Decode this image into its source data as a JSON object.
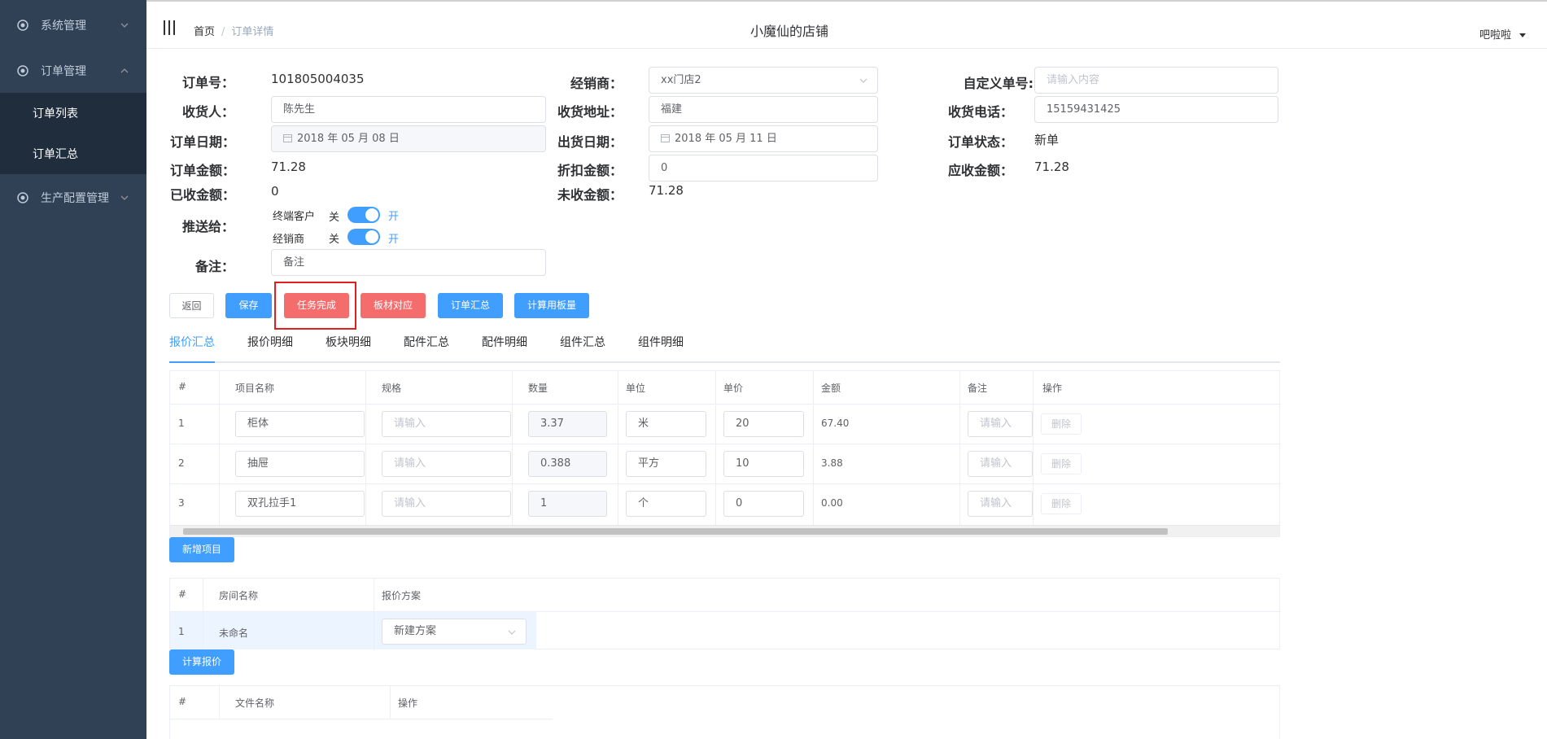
{
  "sidebar": {
    "menu": [
      {
        "label": "系统管理"
      },
      {
        "label": "订单管理"
      },
      {
        "label": "生产配置管理"
      }
    ],
    "submenu": [
      {
        "label": "订单列表"
      },
      {
        "label": "订单汇总"
      }
    ]
  },
  "header": {
    "breadcrumb_home": "首页",
    "breadcrumb_sep": "/",
    "breadcrumb_current": "订单详情",
    "shop_title": "小魔仙的店铺",
    "user": "吧啦啦"
  },
  "form": {
    "order_no_label": "订单号：",
    "order_no": "101805004035",
    "dealer_label": "经销商：",
    "dealer": "xx门店2",
    "custom_no_label": "自定义单号:",
    "custom_no_placeholder": "请输入内容",
    "receiver_label": "收货人：",
    "receiver": "陈先生",
    "address_label": "收货地址：",
    "address": "福建",
    "phone_label": "收货电话：",
    "phone": "15159431425",
    "order_date_label": "订单日期：",
    "order_date": "2018 年 05 月 08 日",
    "ship_date_label": "出货日期：",
    "ship_date": "2018 年 05 月 11 日",
    "status_label": "订单状态：",
    "status": "新单",
    "amount_label": "订单金额：",
    "amount": "71.28",
    "discount_label": "折扣金额：",
    "discount": "0",
    "receivable_label": "应收金额：",
    "receivable": "71.28",
    "received_label": "已收金额：",
    "received": "0",
    "unreceived_label": "未收金额：",
    "unreceived": "71.28",
    "push_label": "推送给：",
    "push_customer": "终端客户",
    "push_dealer": "经销商",
    "switch_off": "关",
    "switch_on": "开",
    "remark_label": "备注：",
    "remark": "备注"
  },
  "buttons": {
    "back": "返回",
    "save": "保存",
    "task_done": "任务完成",
    "board_match": "板材对应",
    "order_summary": "订单汇总",
    "calc_board": "计算用板量"
  },
  "tabs": [
    "报价汇总",
    "报价明细",
    "板块明细",
    "配件汇总",
    "配件明细",
    "组件汇总",
    "组件明细"
  ],
  "quote_table": {
    "headers": [
      "#",
      "项目名称",
      "规格",
      "数量",
      "单位",
      "单价",
      "金额",
      "备注",
      "操作"
    ],
    "input_placeholder": "请输入",
    "delete_label": "删除",
    "rows": [
      {
        "no": "1",
        "name": "柜体",
        "qty": "3.37",
        "unit": "米",
        "price": "20",
        "amount": "67.40"
      },
      {
        "no": "2",
        "name": "抽屉",
        "qty": "0.388",
        "unit": "平方",
        "price": "10",
        "amount": "3.88"
      },
      {
        "no": "3",
        "name": "双孔拉手1",
        "qty": "1",
        "unit": "个",
        "price": "0",
        "amount": "0.00"
      }
    ]
  },
  "add_item_button": "新增项目",
  "room_table": {
    "headers": [
      "#",
      "房间名称",
      "报价方案"
    ],
    "rows": [
      {
        "no": "1",
        "name": "未命名",
        "plan": "新建方案"
      }
    ]
  },
  "calc_quote_button": "计算报价",
  "file_table": {
    "headers": [
      "#",
      "文件名称",
      "操作"
    ]
  }
}
